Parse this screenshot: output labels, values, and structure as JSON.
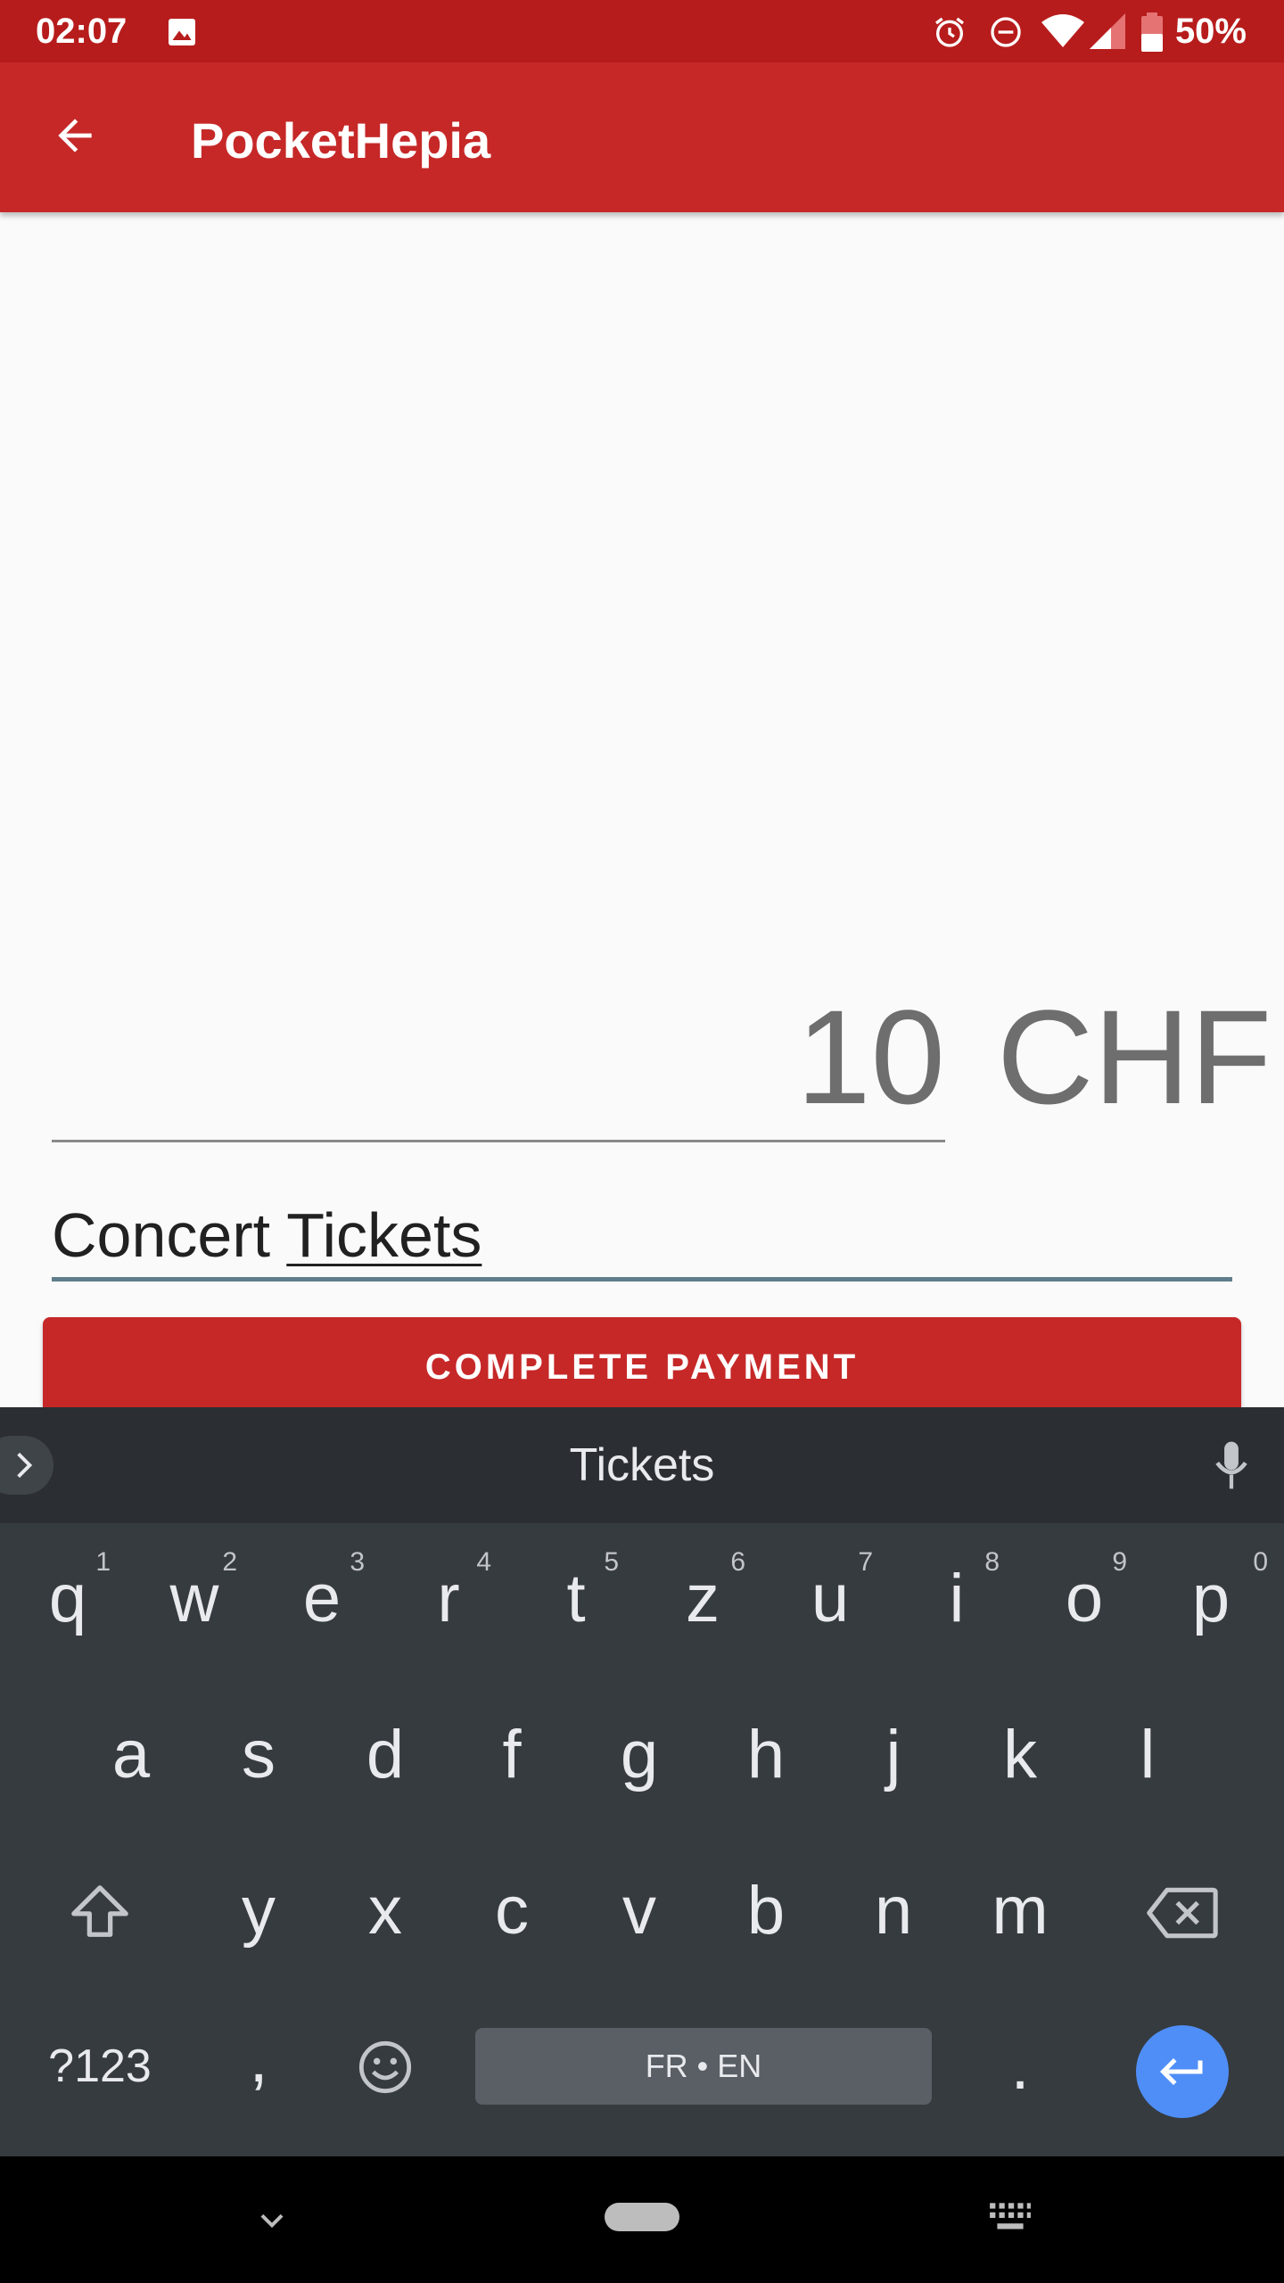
{
  "status_bar": {
    "time": "02:07",
    "battery": "50%",
    "icons": [
      "image-icon",
      "alarm-icon",
      "do-not-disturb-icon",
      "wifi-icon",
      "signal-icon",
      "battery-icon"
    ]
  },
  "app_bar": {
    "title": "PocketHepia",
    "back_icon": "arrow-back-icon"
  },
  "form": {
    "amount": "10",
    "currency": "CHF",
    "description_prefix": "Concert ",
    "description_underlined": "Tickets",
    "submit_label": "COMPLETE PAYMENT"
  },
  "keyboard": {
    "suggestion": "Tickets",
    "row1": [
      {
        "key": "q",
        "hint": "1"
      },
      {
        "key": "w",
        "hint": "2"
      },
      {
        "key": "e",
        "hint": "3"
      },
      {
        "key": "r",
        "hint": "4"
      },
      {
        "key": "t",
        "hint": "5"
      },
      {
        "key": "z",
        "hint": "6"
      },
      {
        "key": "u",
        "hint": "7"
      },
      {
        "key": "i",
        "hint": "8"
      },
      {
        "key": "o",
        "hint": "9"
      },
      {
        "key": "p",
        "hint": "0"
      }
    ],
    "row2": [
      "a",
      "s",
      "d",
      "f",
      "g",
      "h",
      "j",
      "k",
      "l"
    ],
    "row3": [
      "y",
      "x",
      "c",
      "v",
      "b",
      "n",
      "m"
    ],
    "symbols_label": "?123",
    "comma": ",",
    "space_label": "FR • EN",
    "period": "."
  },
  "colors": {
    "status_bar": "#B71C1C",
    "app_bar": "#C62828",
    "button": "#C62828",
    "keyboard_bg": "#363B40",
    "enter_key": "#4F8EF7",
    "field_underline": "#607D8B"
  }
}
